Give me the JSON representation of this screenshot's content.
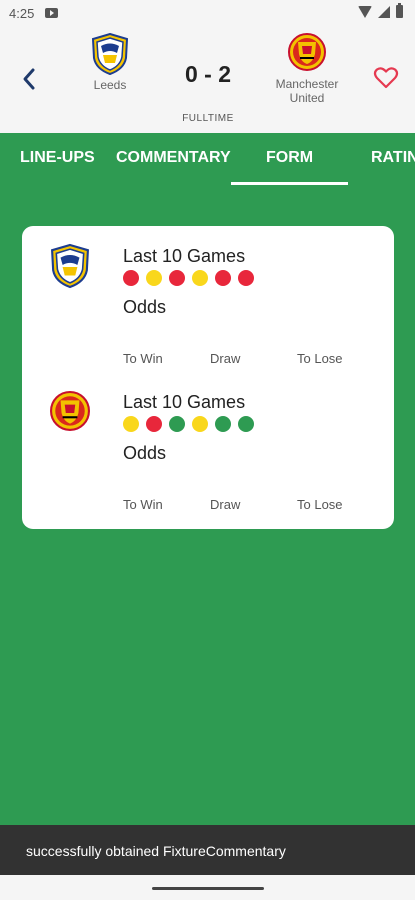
{
  "status_bar": {
    "time": "4:25"
  },
  "match": {
    "home_team": "Leeds",
    "away_team": "Manchester United",
    "score": "0 - 2",
    "status": "FULLTIME"
  },
  "tabs": [
    {
      "label": "LINE-UPS",
      "selected": false
    },
    {
      "label": "COMMENTARY",
      "selected": false
    },
    {
      "label": "FORM",
      "selected": true
    },
    {
      "label": "RATIN",
      "selected": false
    }
  ],
  "form": {
    "colors": {
      "L": "#e8273b",
      "D": "#f9d71c",
      "W": "#2e9b52"
    },
    "teams": [
      {
        "team": "Leeds",
        "title": "Last 10 Games",
        "results": [
          "L",
          "D",
          "L",
          "D",
          "L",
          "L"
        ],
        "odds_title": "Odds",
        "odds_labels": [
          "To Win",
          "Draw",
          "To Lose"
        ]
      },
      {
        "team": "Manchester United",
        "title": "Last 10 Games",
        "results": [
          "D",
          "L",
          "W",
          "D",
          "W",
          "W"
        ],
        "odds_title": "Odds",
        "odds_labels": [
          "To Win",
          "Draw",
          "To Lose"
        ]
      }
    ]
  },
  "snackbar": {
    "message": "successfully obtained FixtureCommentary"
  },
  "icons": {
    "back": "chevron-left-icon",
    "favorite": "heart-outline-icon",
    "favorite_color": "#e53950"
  }
}
